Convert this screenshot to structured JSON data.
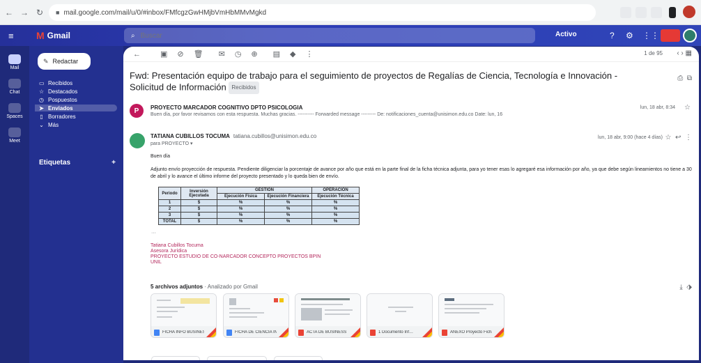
{
  "browser": {
    "url": "mail.google.com/mail/u/0/#inbox/FMfcgzGwHMjbVmHbMMvMgkd",
    "colors": {
      "chrome": "#f1f3f4"
    }
  },
  "gmail": {
    "logo_text": "Gmail",
    "search_placeholder": "Buscar",
    "active_status": "Activo",
    "theme_color": "#25309a"
  },
  "rail": {
    "items": [
      {
        "label": "Mail",
        "icon": "mail-icon"
      },
      {
        "label": "Chat",
        "icon": "chat-icon"
      },
      {
        "label": "Spaces",
        "icon": "spaces-icon"
      },
      {
        "label": "Meet",
        "icon": "meet-icon"
      }
    ]
  },
  "leftnav": {
    "compose_label": "Redactar",
    "items": [
      {
        "label": "Recibidos",
        "icon": "inbox-icon"
      },
      {
        "label": "Destacados",
        "icon": "star-icon"
      },
      {
        "label": "Pospuestos",
        "icon": "clock-icon"
      },
      {
        "label": "Enviados",
        "icon": "send-icon"
      },
      {
        "label": "Borradores",
        "icon": "draft-icon"
      },
      {
        "label": "Más",
        "icon": "chevron-down-icon"
      }
    ],
    "labels_title": "Etiquetas",
    "labels_add": "+"
  },
  "toolbar": {
    "pager": "1 de 95"
  },
  "email": {
    "subject": "Fwd: Presentación equipo de trabajo para el seguimiento de proyectos de Regalías de Ciencia, Tecnología e Innovación - Solicitud de Información",
    "subject_label": "Recibidos",
    "msg1": {
      "avatar_letter": "P",
      "from": "PROYECTO MARCADOR COGNITIVO DPTO PSICOLOGIA",
      "snippet": "Buen día, por favor revisamos con esta respuesta. Muchas gracias. ---------- Forwarded message --------- De: notificaciones_cuenta@unisimon.edu.co  Date: lun, 16",
      "date": "lun, 18 abr, 8:34"
    },
    "msg2": {
      "from": "TATIANA CUBILLOS TOCUMA",
      "email": "tatiana.cubillos@unisimon.edu.co",
      "to": "para PROYECTO ▾",
      "date": "lun, 18 abr, 9:00 (hace 4 días)",
      "greeting": "Buen día",
      "body": "Adjunto envío proyección de respuesta. Pendiente diligenciar la porcentaje de avance por año que está en la parte final de la ficha técnica adjunta, para yo tener esas lo agregaré esa información por año, ya que debe según lineamientos no tiene a 30 de abril y lo avance el último informe del proyecto presentado y lo queda bien de envío.",
      "table_mark": "···",
      "signature": [
        "Tatiana Cubillos Tocuma",
        "Asesora Jurídica",
        "PROYECTO ESTUDIO DE CO-NARCADOR CONCEPTO PROYECTOS BPIN",
        "UNIL"
      ]
    },
    "table": {
      "headers_top": [
        "Periodo",
        "Inversión Ejecutada",
        "GESTIÓN",
        "OPERACIÓN"
      ],
      "headers_sub": [
        "Ejecución Física",
        "Ejecución Financiera",
        "Ejecución Técnica"
      ],
      "rows": [
        [
          "1",
          "$",
          "%",
          "%",
          "%"
        ],
        [
          "2",
          "$",
          "%",
          "%",
          "%"
        ],
        [
          "3",
          "$",
          "%",
          "%",
          "%"
        ],
        [
          "TOTAL",
          "$",
          "%",
          "%",
          "%"
        ]
      ]
    },
    "attachments": {
      "title": "5 archivos adjuntos",
      "subtitle": " · Analizado por Gmail",
      "items": [
        {
          "name": "FICHA INFO BUSINESS",
          "type_color": "#4285f4"
        },
        {
          "name": "FICHA DE CIENCIA INFO",
          "type_color": "#4285f4"
        },
        {
          "name": "ACTA DE BUSINESS",
          "type_color": "#ea4335"
        },
        {
          "name": "1 Documento Inf…",
          "type_color": "#ea4335"
        },
        {
          "name": "ANEXO Proyecto Ficha…",
          "type_color": "#ea4335"
        }
      ]
    }
  }
}
